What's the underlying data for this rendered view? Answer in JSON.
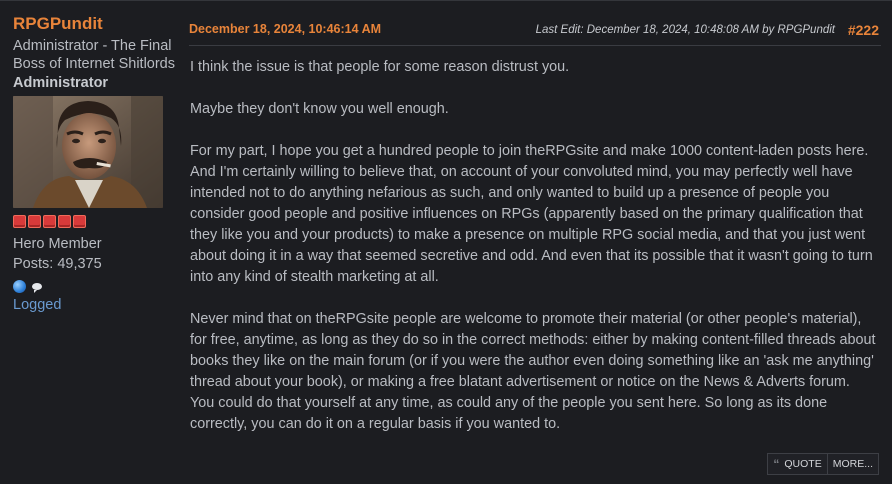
{
  "poster": {
    "name": "RPGPundit",
    "title": "Administrator - The Final Boss of Internet Shitlords",
    "group": "Administrator",
    "star_count": 5,
    "rank": "Hero Member",
    "posts": "Posts: 49,375",
    "icons": [
      "globe-icon",
      "chat-bubble-icon"
    ],
    "logged": "Logged"
  },
  "header": {
    "date": "December 18, 2024, 10:46:14 AM",
    "last_edit": "Last Edit: December 18, 2024, 10:48:08 AM by RPGPundit",
    "post_number": "#222"
  },
  "body": {
    "paragraphs": [
      "I think the issue is that people for some reason distrust you.",
      "Maybe they don't know you well enough.",
      "For my part, I hope you get a hundred people to join theRPGsite and make 1000 content-laden posts here. And I'm certainly willing to believe that, on account of your convoluted mind, you may perfectly well have intended not to do anything nefarious as such, and only wanted to build up a presence of people you consider good people and positive influences on RPGs (apparently based on the primary qualification that they like you and your products) to make a presence on multiple RPG social media, and that you just went about doing it in a way that seemed secretive and odd. And even that its possible that it wasn't going to turn into any kind of stealth marketing at all.",
      "Never mind that on theRPGsite people are welcome to promote their material (or other people's material), for free, anytime, as long as they do so in the correct methods: either by making content-filled threads about books they like on the main forum (or if you were the author even doing something like an 'ask me anything' thread about your book), or making a free blatant advertisement or notice on the News & Adverts forum. You could do that yourself at any time, as could any of the people you sent here. So long as its done correctly, you can do it on a regular basis if you wanted to."
    ]
  },
  "actions": {
    "quote_label": "QUOTE",
    "more_label": "MORE..."
  },
  "colors": {
    "accent": "#e8843a",
    "background": "#1c1d21",
    "text": "#b9bcc2",
    "link": "#6a9ad0",
    "star": "#d83a3a"
  }
}
